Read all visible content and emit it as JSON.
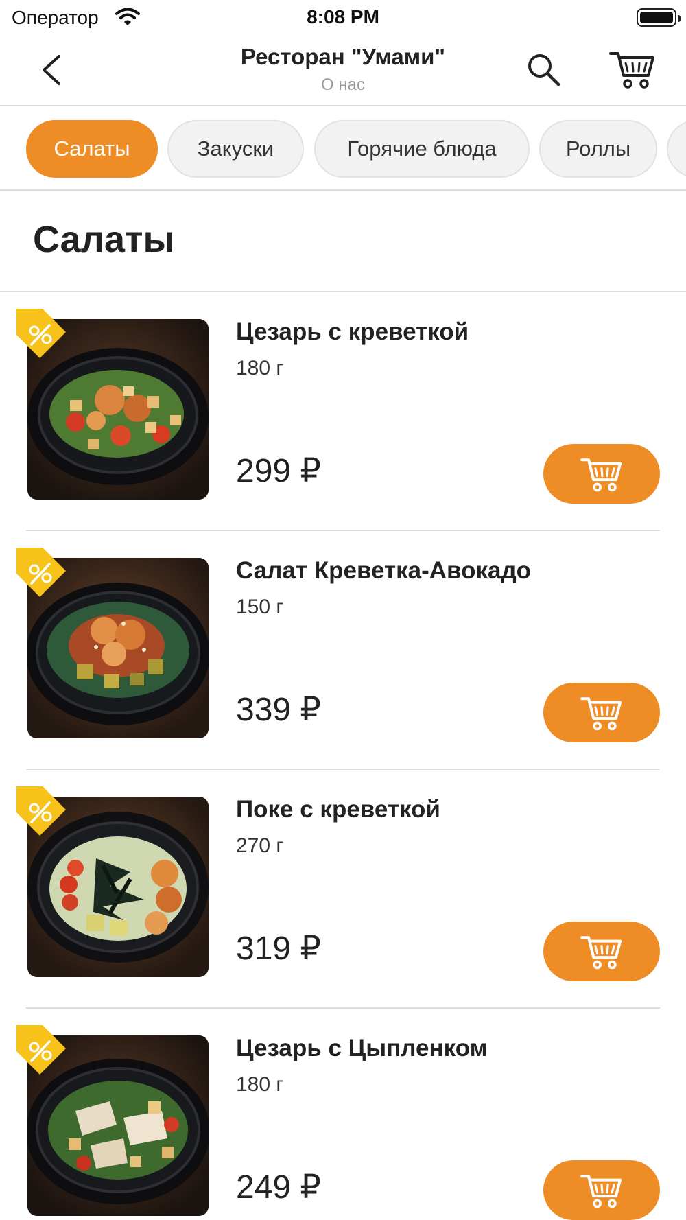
{
  "status_bar": {
    "carrier": "Оператор",
    "time": "8:08 PM"
  },
  "nav": {
    "title": "Ресторан \"Умами\"",
    "subtitle": "О нас"
  },
  "categories": [
    {
      "label": "Салаты",
      "active": true
    },
    {
      "label": "Закуски",
      "active": false
    },
    {
      "label": "Горячие блюда",
      "active": false
    },
    {
      "label": "Роллы",
      "active": false
    }
  ],
  "section": {
    "title": "Салаты"
  },
  "products": [
    {
      "name": "Цезарь с креветкой",
      "weight": "180 г",
      "price": "299 ₽",
      "image": "caesar-shrimp-salad-photo"
    },
    {
      "name": "Салат Креветка-Авокадо",
      "weight": "150 г",
      "price": "339 ₽",
      "image": "shrimp-avocado-salad-photo"
    },
    {
      "name": "Поке с креветкой",
      "weight": "270 г",
      "price": "319 ₽",
      "image": "shrimp-poke-photo"
    },
    {
      "name": "Цезарь с Цыпленком",
      "weight": "180 г",
      "price": "249 ₽",
      "image": "chicken-caesar-salad-photo"
    }
  ],
  "colors": {
    "accent": "#ee8c25",
    "discount_badge": "#f7c21a",
    "divider": "#dcdcdc"
  },
  "icons": {
    "back": "chevron-left-icon",
    "search": "search-icon",
    "cart": "cart-icon",
    "add_to_cart": "cart-icon",
    "discount": "discount-tag-icon",
    "wifi": "wifi-icon",
    "battery": "battery-icon"
  }
}
